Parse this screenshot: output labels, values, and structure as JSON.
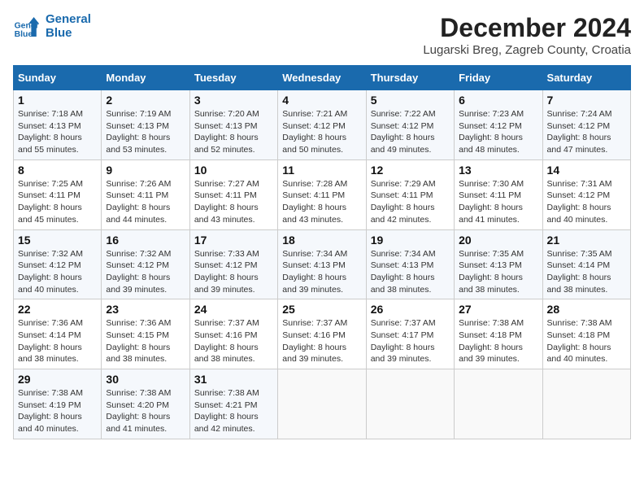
{
  "header": {
    "logo_line1": "General",
    "logo_line2": "Blue",
    "month_title": "December 2024",
    "location": "Lugarski Breg, Zagreb County, Croatia"
  },
  "days_of_week": [
    "Sunday",
    "Monday",
    "Tuesday",
    "Wednesday",
    "Thursday",
    "Friday",
    "Saturday"
  ],
  "weeks": [
    [
      {
        "day": "1",
        "sunrise": "7:18 AM",
        "sunset": "4:13 PM",
        "daylight": "8 hours and 55 minutes."
      },
      {
        "day": "2",
        "sunrise": "7:19 AM",
        "sunset": "4:13 PM",
        "daylight": "8 hours and 53 minutes."
      },
      {
        "day": "3",
        "sunrise": "7:20 AM",
        "sunset": "4:13 PM",
        "daylight": "8 hours and 52 minutes."
      },
      {
        "day": "4",
        "sunrise": "7:21 AM",
        "sunset": "4:12 PM",
        "daylight": "8 hours and 50 minutes."
      },
      {
        "day": "5",
        "sunrise": "7:22 AM",
        "sunset": "4:12 PM",
        "daylight": "8 hours and 49 minutes."
      },
      {
        "day": "6",
        "sunrise": "7:23 AM",
        "sunset": "4:12 PM",
        "daylight": "8 hours and 48 minutes."
      },
      {
        "day": "7",
        "sunrise": "7:24 AM",
        "sunset": "4:12 PM",
        "daylight": "8 hours and 47 minutes."
      }
    ],
    [
      {
        "day": "8",
        "sunrise": "7:25 AM",
        "sunset": "4:11 PM",
        "daylight": "8 hours and 45 minutes."
      },
      {
        "day": "9",
        "sunrise": "7:26 AM",
        "sunset": "4:11 PM",
        "daylight": "8 hours and 44 minutes."
      },
      {
        "day": "10",
        "sunrise": "7:27 AM",
        "sunset": "4:11 PM",
        "daylight": "8 hours and 43 minutes."
      },
      {
        "day": "11",
        "sunrise": "7:28 AM",
        "sunset": "4:11 PM",
        "daylight": "8 hours and 43 minutes."
      },
      {
        "day": "12",
        "sunrise": "7:29 AM",
        "sunset": "4:11 PM",
        "daylight": "8 hours and 42 minutes."
      },
      {
        "day": "13",
        "sunrise": "7:30 AM",
        "sunset": "4:11 PM",
        "daylight": "8 hours and 41 minutes."
      },
      {
        "day": "14",
        "sunrise": "7:31 AM",
        "sunset": "4:12 PM",
        "daylight": "8 hours and 40 minutes."
      }
    ],
    [
      {
        "day": "15",
        "sunrise": "7:32 AM",
        "sunset": "4:12 PM",
        "daylight": "8 hours and 40 minutes."
      },
      {
        "day": "16",
        "sunrise": "7:32 AM",
        "sunset": "4:12 PM",
        "daylight": "8 hours and 39 minutes."
      },
      {
        "day": "17",
        "sunrise": "7:33 AM",
        "sunset": "4:12 PM",
        "daylight": "8 hours and 39 minutes."
      },
      {
        "day": "18",
        "sunrise": "7:34 AM",
        "sunset": "4:13 PM",
        "daylight": "8 hours and 39 minutes."
      },
      {
        "day": "19",
        "sunrise": "7:34 AM",
        "sunset": "4:13 PM",
        "daylight": "8 hours and 38 minutes."
      },
      {
        "day": "20",
        "sunrise": "7:35 AM",
        "sunset": "4:13 PM",
        "daylight": "8 hours and 38 minutes."
      },
      {
        "day": "21",
        "sunrise": "7:35 AM",
        "sunset": "4:14 PM",
        "daylight": "8 hours and 38 minutes."
      }
    ],
    [
      {
        "day": "22",
        "sunrise": "7:36 AM",
        "sunset": "4:14 PM",
        "daylight": "8 hours and 38 minutes."
      },
      {
        "day": "23",
        "sunrise": "7:36 AM",
        "sunset": "4:15 PM",
        "daylight": "8 hours and 38 minutes."
      },
      {
        "day": "24",
        "sunrise": "7:37 AM",
        "sunset": "4:16 PM",
        "daylight": "8 hours and 38 minutes."
      },
      {
        "day": "25",
        "sunrise": "7:37 AM",
        "sunset": "4:16 PM",
        "daylight": "8 hours and 39 minutes."
      },
      {
        "day": "26",
        "sunrise": "7:37 AM",
        "sunset": "4:17 PM",
        "daylight": "8 hours and 39 minutes."
      },
      {
        "day": "27",
        "sunrise": "7:38 AM",
        "sunset": "4:18 PM",
        "daylight": "8 hours and 39 minutes."
      },
      {
        "day": "28",
        "sunrise": "7:38 AM",
        "sunset": "4:18 PM",
        "daylight": "8 hours and 40 minutes."
      }
    ],
    [
      {
        "day": "29",
        "sunrise": "7:38 AM",
        "sunset": "4:19 PM",
        "daylight": "8 hours and 40 minutes."
      },
      {
        "day": "30",
        "sunrise": "7:38 AM",
        "sunset": "4:20 PM",
        "daylight": "8 hours and 41 minutes."
      },
      {
        "day": "31",
        "sunrise": "7:38 AM",
        "sunset": "4:21 PM",
        "daylight": "8 hours and 42 minutes."
      },
      null,
      null,
      null,
      null
    ]
  ],
  "labels": {
    "sunrise": "Sunrise:",
    "sunset": "Sunset:",
    "daylight": "Daylight:"
  }
}
